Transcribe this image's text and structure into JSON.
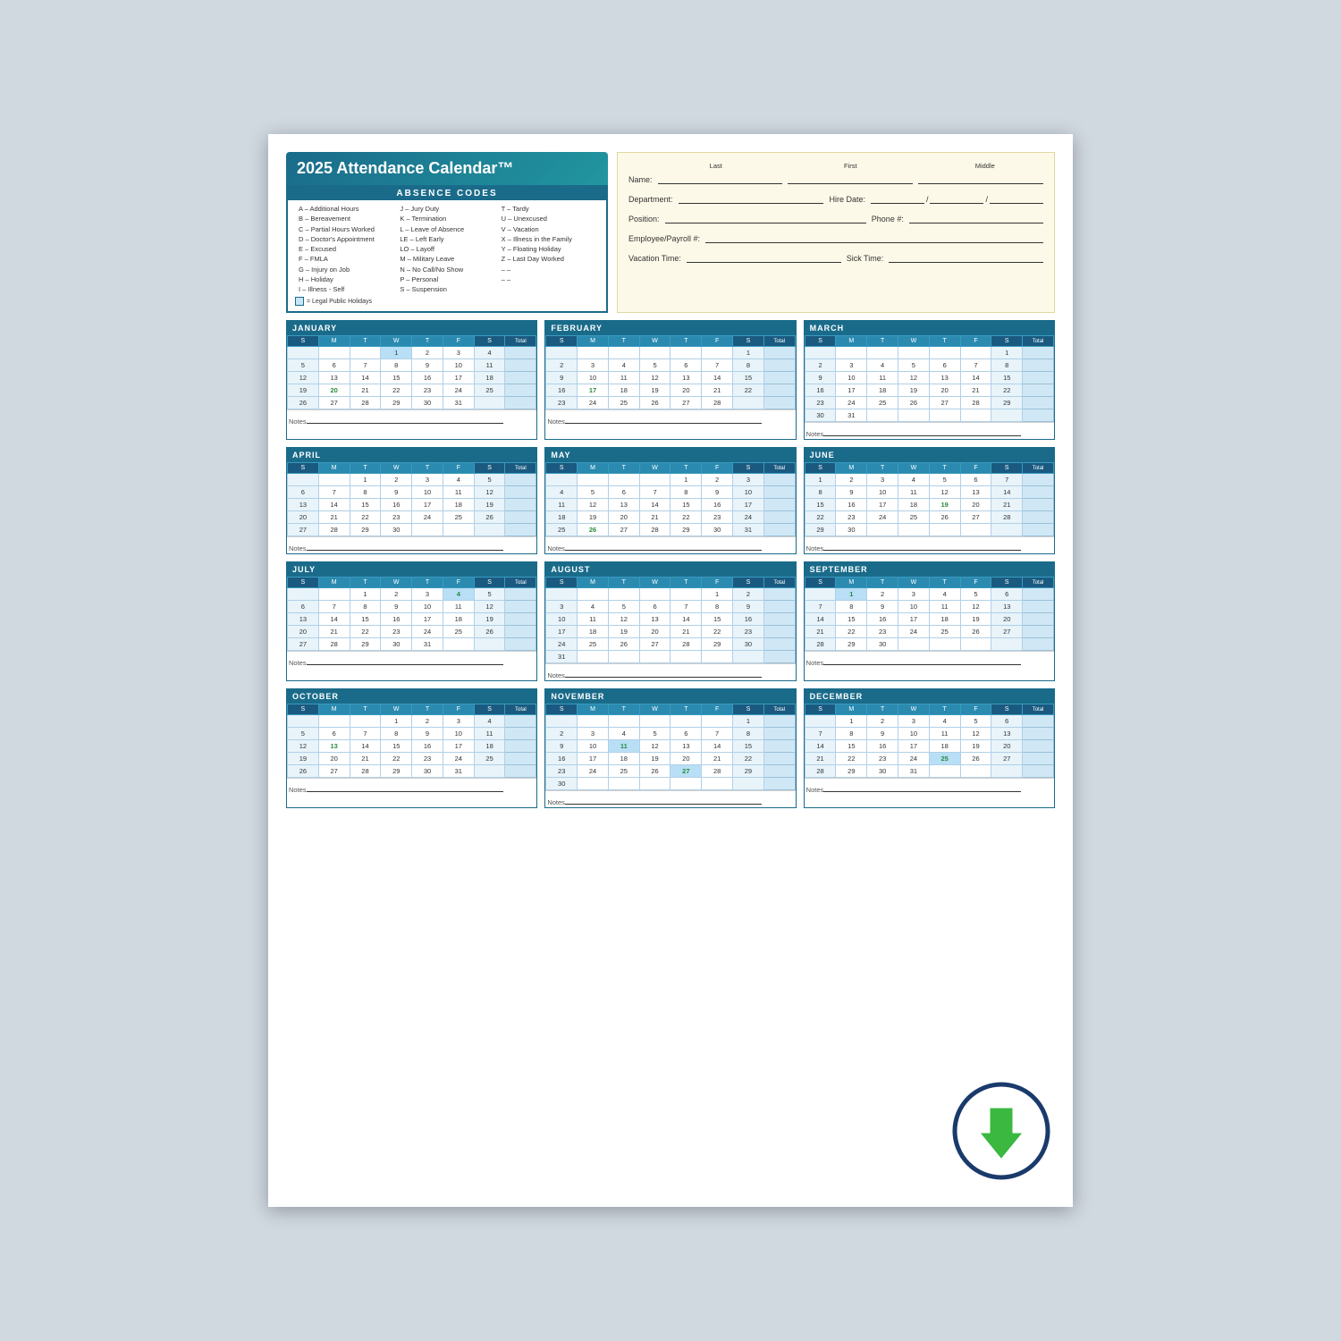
{
  "title": "2025 Attendance Calendar™",
  "absence_codes_title": "ABSENCE CODES",
  "codes_col1": [
    "A – Additional Hours",
    "B – Bereavement",
    "C – Partial Hours Worked",
    "D – Doctor's Appointment",
    "E – Excused",
    "F – FMLA",
    "G – Injury on Job",
    "H – Holiday",
    "I – Illness - Self"
  ],
  "codes_col2": [
    "J – Jury Duty",
    "K – Termination",
    "L – Leave of Absence",
    "LE – Left Early",
    "LO – Layoff",
    "M – Military Leave",
    "N – No Call/No Show",
    "P – Personal",
    "S – Suspension"
  ],
  "codes_col3": [
    "T – Tardy",
    "U – Unexcused",
    "V – Vacation",
    "X – Illness in the Family",
    "Y – Floating Holiday",
    "Z – Last Day Worked",
    "– –",
    "– –"
  ],
  "holiday_note": "= Legal Public Holidays",
  "form": {
    "name_label": "Name:",
    "last_label": "Last",
    "first_label": "First",
    "middle_label": "Middle",
    "dept_label": "Department:",
    "hire_label": "Hire Date:",
    "position_label": "Position:",
    "phone_label": "Phone #:",
    "emp_label": "Employee/Payroll #:",
    "vacation_label": "Vacation Time:",
    "sick_label": "Sick Time:"
  },
  "months": [
    {
      "name": "JANUARY",
      "weeks": [
        [
          "",
          "",
          "",
          "1",
          "2",
          "3",
          "4",
          ""
        ],
        [
          "5",
          "6",
          "7",
          "8",
          "9",
          "10",
          "11",
          ""
        ],
        [
          "12",
          "13",
          "14",
          "15",
          "16",
          "17",
          "18",
          ""
        ],
        [
          "19",
          "20",
          "21",
          "22",
          "23",
          "24",
          "25",
          ""
        ],
        [
          "26",
          "27",
          "28",
          "29",
          "30",
          "31",
          "",
          ""
        ]
      ],
      "highlights": {
        "20": "green"
      },
      "holidays": {
        "1": true
      }
    },
    {
      "name": "FEBRUARY",
      "weeks": [
        [
          "",
          "",
          "",
          "",
          "",
          "",
          "1",
          ""
        ],
        [
          "2",
          "3",
          "4",
          "5",
          "6",
          "7",
          "8",
          ""
        ],
        [
          "9",
          "10",
          "11",
          "12",
          "13",
          "14",
          "15",
          ""
        ],
        [
          "16",
          "17",
          "18",
          "19",
          "20",
          "21",
          "22",
          ""
        ],
        [
          "23",
          "24",
          "25",
          "26",
          "27",
          "28",
          "",
          ""
        ]
      ],
      "highlights": {
        "17": "green"
      },
      "holidays": {}
    },
    {
      "name": "MARCH",
      "weeks": [
        [
          "",
          "",
          "",
          "",
          "",
          "",
          "1",
          ""
        ],
        [
          "2",
          "3",
          "4",
          "5",
          "6",
          "7",
          "8",
          ""
        ],
        [
          "9",
          "10",
          "11",
          "12",
          "13",
          "14",
          "15",
          ""
        ],
        [
          "16",
          "17",
          "18",
          "19",
          "20",
          "21",
          "22",
          ""
        ],
        [
          "23",
          "24",
          "25",
          "26",
          "27",
          "28",
          "29",
          ""
        ],
        [
          "30",
          "31",
          "",
          "",
          "",
          "",
          "",
          ""
        ]
      ],
      "highlights": {},
      "holidays": {}
    },
    {
      "name": "APRIL",
      "weeks": [
        [
          "",
          "",
          "1",
          "2",
          "3",
          "4",
          "5",
          ""
        ],
        [
          "6",
          "7",
          "8",
          "9",
          "10",
          "11",
          "12",
          ""
        ],
        [
          "13",
          "14",
          "15",
          "16",
          "17",
          "18",
          "19",
          ""
        ],
        [
          "20",
          "21",
          "22",
          "23",
          "24",
          "25",
          "26",
          ""
        ],
        [
          "27",
          "28",
          "29",
          "30",
          "",
          "",
          "",
          ""
        ]
      ],
      "highlights": {},
      "holidays": {}
    },
    {
      "name": "MAY",
      "weeks": [
        [
          "",
          "",
          "",
          "",
          "1",
          "2",
          "3",
          ""
        ],
        [
          "4",
          "5",
          "6",
          "7",
          "8",
          "9",
          "10",
          ""
        ],
        [
          "11",
          "12",
          "13",
          "14",
          "15",
          "16",
          "17",
          ""
        ],
        [
          "18",
          "19",
          "20",
          "21",
          "22",
          "23",
          "24",
          ""
        ],
        [
          "25",
          "26",
          "27",
          "28",
          "29",
          "30",
          "31",
          ""
        ]
      ],
      "highlights": {
        "26": "green"
      },
      "holidays": {}
    },
    {
      "name": "JUNE",
      "weeks": [
        [
          "1",
          "2",
          "3",
          "4",
          "5",
          "6",
          "7",
          ""
        ],
        [
          "8",
          "9",
          "10",
          "11",
          "12",
          "13",
          "14",
          ""
        ],
        [
          "15",
          "16",
          "17",
          "18",
          "19",
          "20",
          "21",
          ""
        ],
        [
          "22",
          "23",
          "24",
          "25",
          "26",
          "27",
          "28",
          ""
        ],
        [
          "29",
          "30",
          "",
          "",
          "",
          "",
          "",
          ""
        ]
      ],
      "highlights": {
        "19": "green"
      },
      "holidays": {}
    },
    {
      "name": "JULY",
      "weeks": [
        [
          "",
          "",
          "1",
          "2",
          "3",
          "4",
          "5",
          ""
        ],
        [
          "6",
          "7",
          "8",
          "9",
          "10",
          "11",
          "12",
          ""
        ],
        [
          "13",
          "14",
          "15",
          "16",
          "17",
          "18",
          "19",
          ""
        ],
        [
          "20",
          "21",
          "22",
          "23",
          "24",
          "25",
          "26",
          ""
        ],
        [
          "27",
          "28",
          "29",
          "30",
          "31",
          "",
          "",
          ""
        ]
      ],
      "highlights": {
        "4": "green"
      },
      "holidays": {
        "4": true
      }
    },
    {
      "name": "AUGUST",
      "weeks": [
        [
          "",
          "",
          "",
          "",
          "",
          "1",
          "2",
          ""
        ],
        [
          "3",
          "4",
          "5",
          "6",
          "7",
          "8",
          "9",
          ""
        ],
        [
          "10",
          "11",
          "12",
          "13",
          "14",
          "15",
          "16",
          ""
        ],
        [
          "17",
          "18",
          "19",
          "20",
          "21",
          "22",
          "23",
          ""
        ],
        [
          "24",
          "25",
          "26",
          "27",
          "28",
          "29",
          "30",
          ""
        ],
        [
          "31",
          "",
          "",
          "",
          "",
          "",
          "",
          ""
        ]
      ],
      "highlights": {},
      "holidays": {}
    },
    {
      "name": "SEPTEMBER",
      "weeks": [
        [
          "",
          "1",
          "2",
          "3",
          "4",
          "5",
          "6",
          ""
        ],
        [
          "7",
          "8",
          "9",
          "10",
          "11",
          "12",
          "13",
          ""
        ],
        [
          "14",
          "15",
          "16",
          "17",
          "18",
          "19",
          "20",
          ""
        ],
        [
          "21",
          "22",
          "23",
          "24",
          "25",
          "26",
          "27",
          ""
        ],
        [
          "28",
          "29",
          "30",
          "",
          "",
          "",
          "",
          ""
        ]
      ],
      "highlights": {
        "1": "green"
      },
      "holidays": {
        "1": true
      }
    },
    {
      "name": "OCTOBER",
      "weeks": [
        [
          "",
          "",
          "",
          "1",
          "2",
          "3",
          "4",
          ""
        ],
        [
          "5",
          "6",
          "7",
          "8",
          "9",
          "10",
          "11",
          ""
        ],
        [
          "12",
          "13",
          "14",
          "15",
          "16",
          "17",
          "18",
          ""
        ],
        [
          "19",
          "20",
          "21",
          "22",
          "23",
          "24",
          "25",
          ""
        ],
        [
          "26",
          "27",
          "28",
          "29",
          "30",
          "31",
          "",
          ""
        ]
      ],
      "highlights": {
        "13": "green"
      },
      "holidays": {}
    },
    {
      "name": "NOVEMBER",
      "weeks": [
        [
          "",
          "",
          "",
          "",
          "",
          "",
          "1",
          ""
        ],
        [
          "2",
          "3",
          "4",
          "5",
          "6",
          "7",
          "8",
          ""
        ],
        [
          "9",
          "10",
          "11",
          "12",
          "13",
          "14",
          "15",
          ""
        ],
        [
          "16",
          "17",
          "18",
          "19",
          "20",
          "21",
          "22",
          ""
        ],
        [
          "23",
          "24",
          "25",
          "26",
          "27",
          "28",
          "29",
          ""
        ],
        [
          "30",
          "",
          "",
          "",
          "",
          "",
          "",
          ""
        ]
      ],
      "highlights": {
        "11": "green",
        "27": "green"
      },
      "holidays": {
        "11": true,
        "27": true
      }
    },
    {
      "name": "DECEMBER",
      "weeks": [
        [
          "",
          "1",
          "2",
          "3",
          "4",
          "5",
          "6",
          ""
        ],
        [
          "7",
          "8",
          "9",
          "10",
          "11",
          "12",
          "13",
          ""
        ],
        [
          "14",
          "15",
          "16",
          "17",
          "18",
          "19",
          "20",
          ""
        ],
        [
          "21",
          "22",
          "23",
          "24",
          "25",
          "26",
          "27",
          ""
        ],
        [
          "28",
          "29",
          "30",
          "31",
          "",
          "",
          "",
          ""
        ]
      ],
      "highlights": {
        "25": "green"
      },
      "holidays": {
        "25": true
      }
    }
  ],
  "day_headers": [
    "S",
    "M",
    "T",
    "W",
    "T",
    "F",
    "S",
    "Total"
  ],
  "notes_label": "Notes"
}
